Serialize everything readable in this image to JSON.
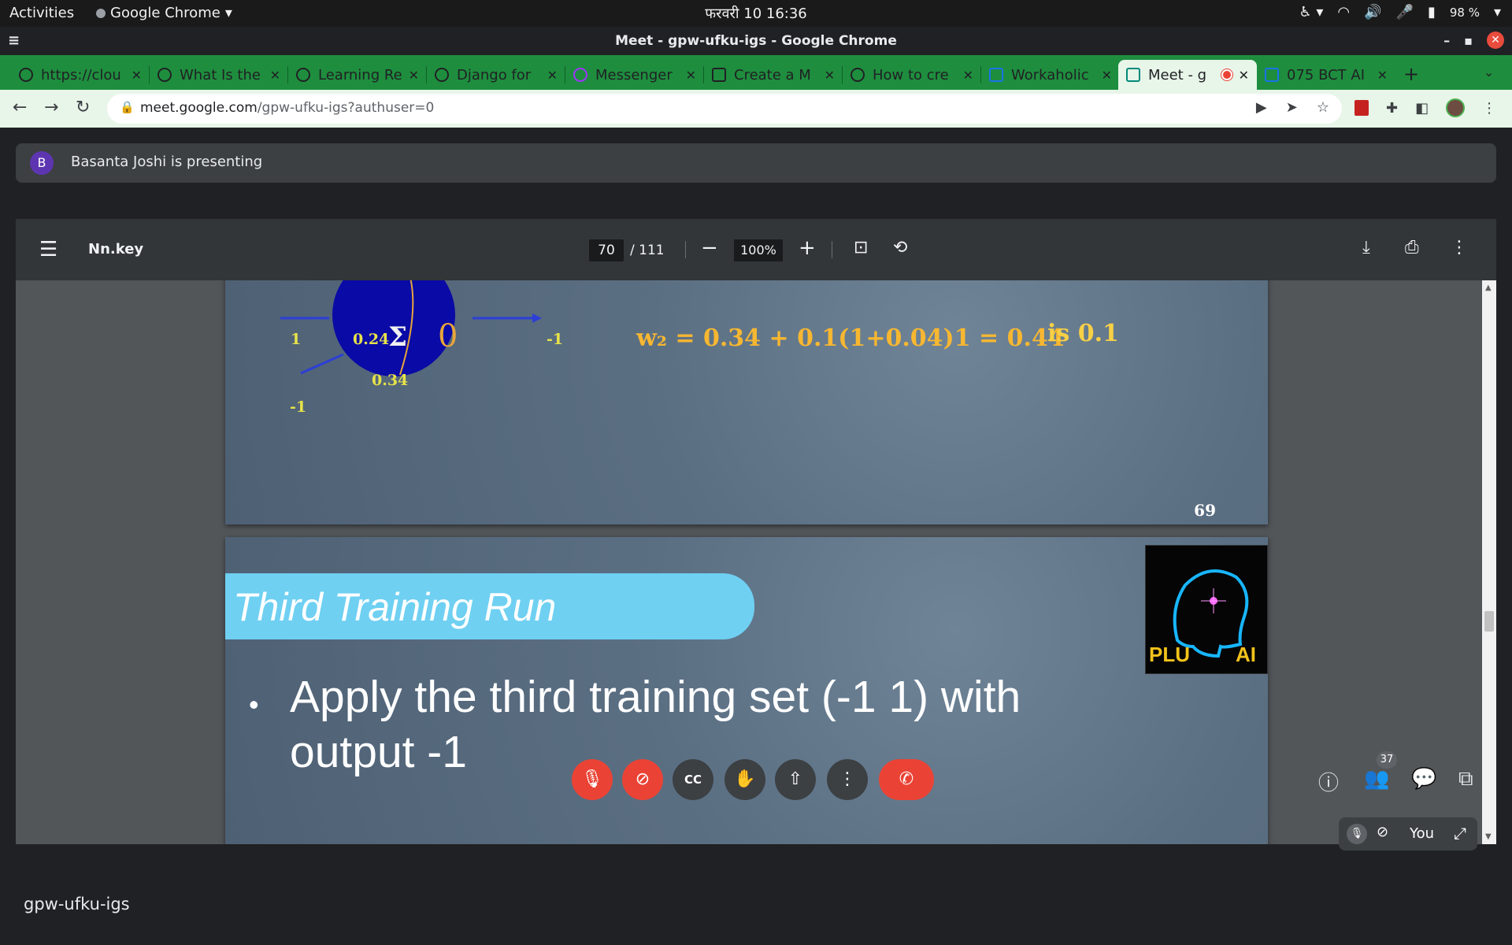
{
  "os_bar": {
    "activities": "Activities",
    "app": "Google Chrome",
    "clock": "फरवरी 10  16:36",
    "battery": "98 %"
  },
  "window": {
    "title": "Meet - gpw-ufku-igs - Google Chrome"
  },
  "tabs": [
    {
      "label": "https://clou",
      "active": false
    },
    {
      "label": "What Is the",
      "active": false
    },
    {
      "label": "Learning Re",
      "active": false
    },
    {
      "label": "Django for",
      "active": false
    },
    {
      "label": "Messenger",
      "active": false
    },
    {
      "label": "Create a M",
      "active": false
    },
    {
      "label": "How to cre",
      "active": false
    },
    {
      "label": "Workaholic",
      "active": false
    },
    {
      "label": "Meet - g",
      "active": true
    },
    {
      "label": "075 BCT AI",
      "active": false
    }
  ],
  "omnibox": {
    "url_host": "meet.google.com",
    "url_path": "/gpw-ufku-igs?authuser=0"
  },
  "presenting_banner": {
    "avatar_letter": "B",
    "text": "Basanta Joshi is presenting"
  },
  "pdf": {
    "filename": "Nn.key",
    "current_page": "70",
    "total_pages": "/ 111",
    "zoom": "100%"
  },
  "slide1": {
    "input1": "1",
    "weight1": "0.24",
    "sigma": "Σ",
    "zero": "0",
    "weight2": "0.34",
    "input2": "-1",
    "output": "-1",
    "equation": "w₂ = 0.34 + 0.1(1+0.04)1 = 0.44",
    "note": "is 0.1",
    "page_number": "69"
  },
  "slide2": {
    "title": "Third Training Run",
    "bullet": "Apply the third training set (-1 1) with output -1",
    "logo_left": "PLU",
    "logo_right": "AI"
  },
  "self_tile": {
    "label": "You"
  },
  "meeting": {
    "code": "gpw-ufku-igs",
    "participants": "37"
  }
}
